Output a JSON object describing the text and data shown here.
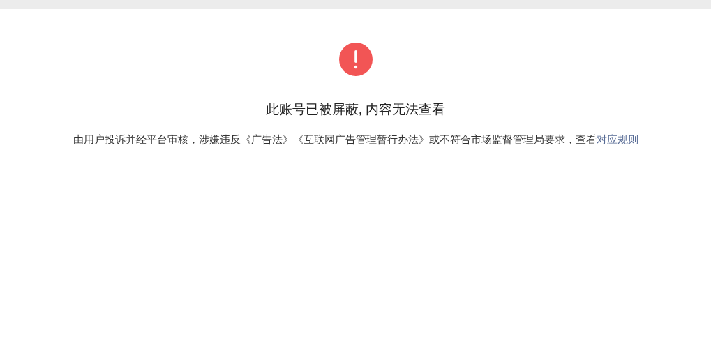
{
  "notice": {
    "title": "此账号已被屏蔽, 内容无法查看",
    "message": "由用户投诉并经平台审核，涉嫌违反《广告法》《互联网广告管理暂行办法》或不符合市场监督管理局要求，查看",
    "link": "对应规则"
  }
}
